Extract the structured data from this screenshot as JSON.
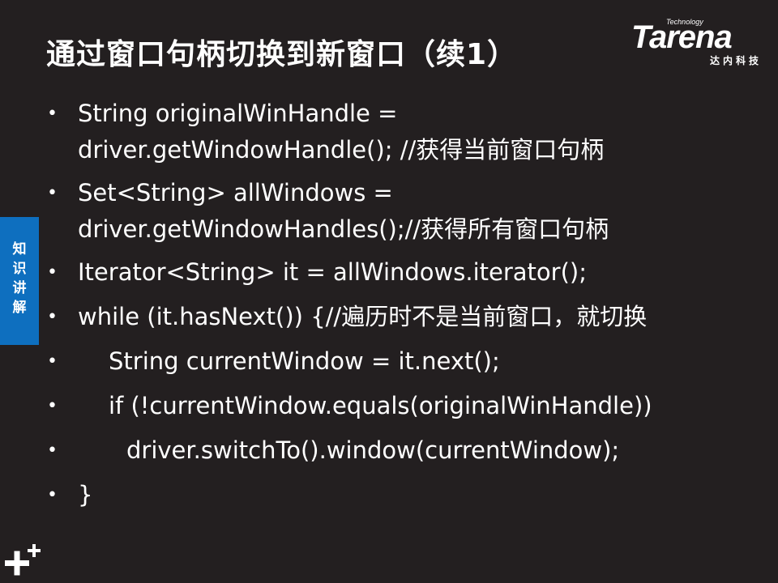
{
  "title": "通过窗口句柄切换到新窗口（续1）",
  "logo": {
    "tagline": "Technology",
    "brand": "Tarena",
    "chinese": "达内科技"
  },
  "side_tab": "知识讲解",
  "bullet_char": "•",
  "bullets": [
    {
      "text": "String originalWinHandle  = driver.getWindowHandle(); //获得当前窗口句柄"
    },
    {
      "text": "Set<String> allWindows = driver.getWindowHandles();//获得所有窗口句柄"
    },
    {
      "text": "Iterator<String> it = allWindows.iterator();"
    },
    {
      "text": "while (it.hasNext()) {//遍历时不是当前窗口，就切换"
    },
    {
      "text": "String currentWindow = it.next();"
    },
    {
      "text": "if (!currentWindow.equals(originalWinHandle))"
    },
    {
      "text": "driver.switchTo().window(currentWindow);"
    },
    {
      "text": "}"
    }
  ],
  "colors": {
    "background": "#231f20",
    "accent": "#0e6fbf",
    "text": "#ffffff"
  },
  "icons": [
    "plus-plus-icon"
  ]
}
